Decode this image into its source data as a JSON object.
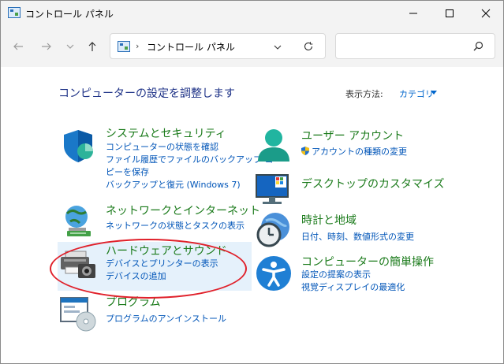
{
  "window": {
    "title": "コントロール パネル"
  },
  "address_bar": {
    "path": "コントロール パネル",
    "separator": "›"
  },
  "search": {
    "placeholder": ""
  },
  "content": {
    "heading": "コンピューターの設定を調整します",
    "view_by_label": "表示方法:",
    "view_by_value": "カテゴリ"
  },
  "categories": {
    "system_security": {
      "title": "システムとセキュリティ",
      "links": [
        "コンピューターの状態を確認",
        "ファイル履歴でファイルのバックアップ コ",
        "ピーを保存",
        "バックアップと復元 (Windows 7)"
      ]
    },
    "network": {
      "title": "ネットワークとインターネット",
      "links": [
        "ネットワークの状態とタスクの表示"
      ]
    },
    "hardware": {
      "title": "ハードウェアとサウンド",
      "links": [
        "デバイスとプリンターの表示",
        "デバイスの追加"
      ]
    },
    "programs": {
      "title": "プログラム",
      "links": [
        "プログラムのアンインストール"
      ]
    },
    "user_accounts": {
      "title": "ユーザー アカウント",
      "links": [
        "アカウントの種類の変更"
      ]
    },
    "appearance": {
      "title": "デスクトップのカスタマイズ",
      "links": []
    },
    "clock_region": {
      "title": "時計と地域",
      "links": [
        "日付、時刻、数値形式の変更"
      ]
    },
    "ease_of_access": {
      "title": "コンピューターの簡単操作",
      "links": [
        "設定の提案の表示",
        "視覚ディスプレイの最適化"
      ]
    }
  },
  "colors": {
    "category_title": "#1a7a1a",
    "link": "#0055b8",
    "heading": "#1e3287",
    "highlight_bg": "#e5f1fb",
    "annotation_oval": "#e0202a"
  }
}
